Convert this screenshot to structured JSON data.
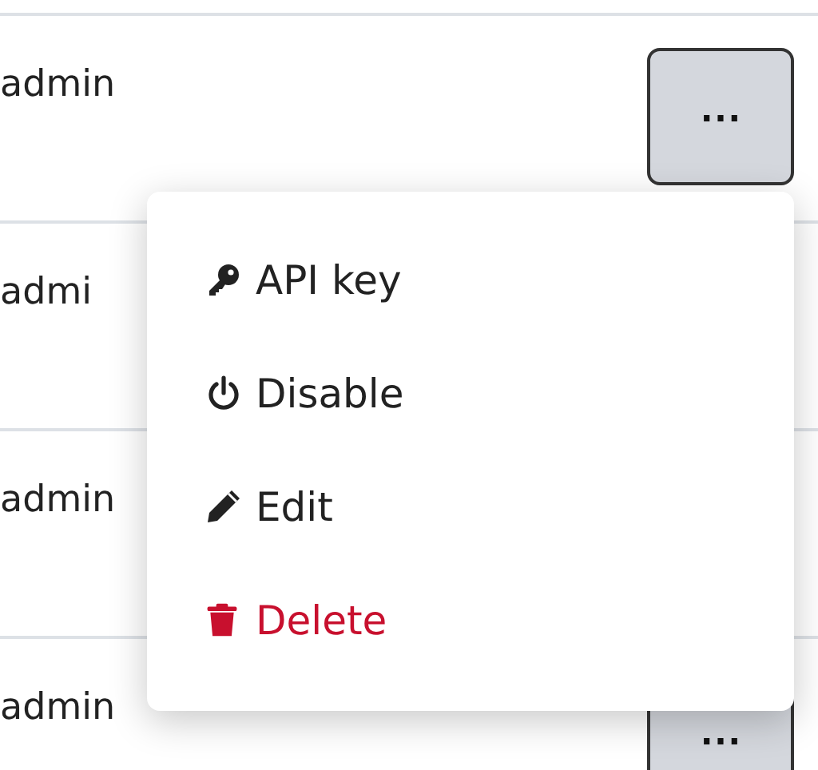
{
  "rows": [
    {
      "user": "admin",
      "menu_button": "⋯"
    },
    {
      "user": "admi"
    },
    {
      "user": "admin"
    },
    {
      "user": "admin",
      "menu_button": "⋯"
    }
  ],
  "menu": {
    "items": [
      {
        "label": "API key",
        "kind": "normal"
      },
      {
        "label": "Disable",
        "kind": "normal"
      },
      {
        "label": "Edit",
        "kind": "normal"
      },
      {
        "label": "Delete",
        "kind": "danger"
      }
    ]
  }
}
